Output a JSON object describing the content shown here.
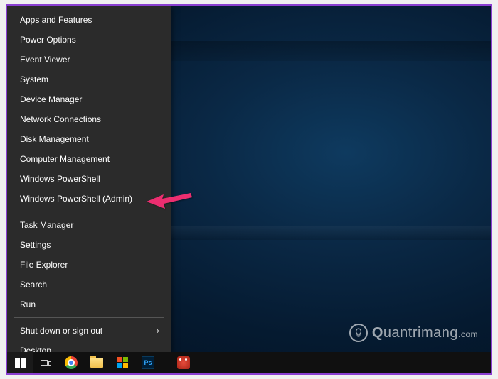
{
  "context_menu": {
    "group1": [
      "Apps and Features",
      "Power Options",
      "Event Viewer",
      "System",
      "Device Manager",
      "Network Connections",
      "Disk Management",
      "Computer Management",
      "Windows PowerShell",
      "Windows PowerShell (Admin)"
    ],
    "group2": [
      "Task Manager",
      "Settings",
      "File Explorer",
      "Search",
      "Run"
    ],
    "group3": [
      {
        "label": "Shut down or sign out",
        "submenu": true
      },
      {
        "label": "Desktop",
        "submenu": false
      }
    ]
  },
  "annotation": {
    "target_item": "Windows PowerShell (Admin)",
    "arrow_color": "#ec2d6f"
  },
  "taskbar": {
    "items": [
      {
        "name": "start",
        "title": "Start"
      },
      {
        "name": "task-view",
        "title": "Task View"
      },
      {
        "name": "chrome",
        "title": "Google Chrome"
      },
      {
        "name": "file-explorer",
        "title": "File Explorer"
      },
      {
        "name": "microsoft-store",
        "title": "Microsoft Store"
      },
      {
        "name": "photoshop",
        "title": "Ps"
      },
      {
        "name": "malware-tool",
        "title": "Security Tool"
      }
    ]
  },
  "watermark": {
    "brand_first": "Q",
    "brand_rest": "uantrimang",
    "suffix": ".com"
  }
}
